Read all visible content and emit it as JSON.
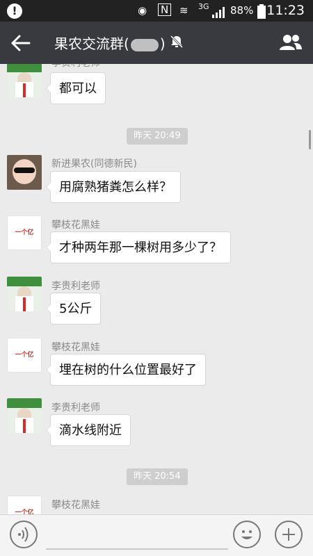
{
  "status": {
    "network": "3G",
    "battery": "88%",
    "time": "11:23"
  },
  "header": {
    "title_prefix": "果农交流群(",
    "title_suffix": ")"
  },
  "messages": [
    {
      "name": "李贵利老师",
      "text": "都可以",
      "avatar": "teacher"
    },
    {
      "timestamp": "昨天 20:49"
    },
    {
      "name": "新进果农(同德新民)",
      "text": "用腐熟猪粪怎么样？",
      "avatar": "baby"
    },
    {
      "name": "攀枝花黑娃",
      "text": "才种两年那一棵树用多少了？",
      "avatar": "logo"
    },
    {
      "name": "李贵利老师",
      "text": "5公斤",
      "avatar": "teacher"
    },
    {
      "name": "攀枝花黑娃",
      "text": "埋在树的什么位置最好了",
      "avatar": "logo"
    },
    {
      "name": "李贵利老师",
      "text": "滴水线附近",
      "avatar": "teacher"
    },
    {
      "timestamp": "昨天 20:54"
    },
    {
      "name": "攀枝花黑娃",
      "text": "",
      "avatar": "logo"
    }
  ],
  "logo_text": {
    "top": "",
    "big": "一个亿",
    "bottom": ""
  },
  "icons": {
    "back": "arrow-left-icon",
    "mute": "bell-muted-icon",
    "group": "group-icon",
    "voice": "voice-icon",
    "emoji": "emoji-icon",
    "plus": "plus-icon"
  }
}
